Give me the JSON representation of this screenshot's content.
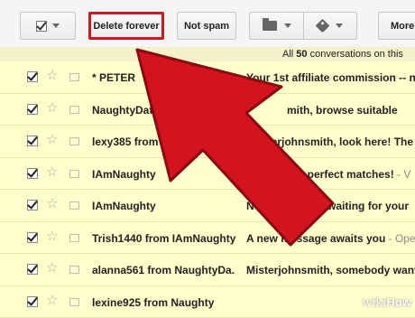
{
  "toolbar": {
    "delete_label": "Delete forever",
    "spam_label": "Not spam",
    "more_label": "More"
  },
  "banner": {
    "prefix": "All ",
    "count": "50",
    "suffix": " conversations on this"
  },
  "rows": [
    {
      "sender": "* PETER",
      "subject": "Your 1st affiliate commission -- n",
      "snippet": ""
    },
    {
      "sender": "NaughtyDate",
      "subject": "mith, browse suitable",
      "snippet": ""
    },
    {
      "sender": "lexy385 from Naught",
      "subject": "sterjohnsmith, look here! The",
      "snippet": ""
    },
    {
      "sender": "IAmNaughty",
      "subject": "our perfect matches!",
      "snippet": " - V"
    },
    {
      "sender": "IAmNaughty",
      "subject": "New m      s are waiting for your",
      "snippet": ""
    },
    {
      "sender": "Trish1440 from IAmNaughty",
      "subject": "A new message awaits you",
      "snippet": " - Ope"
    },
    {
      "sender": "alanna561 from NaughtyDa.",
      "subject": "Misterjohnsmith, somebody want",
      "snippet": ""
    },
    {
      "sender": "lexine925 from Naughty",
      "subject": "",
      "snippet": ""
    }
  ],
  "watermark": {
    "pre": "wiki",
    "post": "How"
  },
  "colors": {
    "highlight": "#d0181f",
    "arrow": "#d3141e",
    "row_bg": "#ffffcc"
  }
}
